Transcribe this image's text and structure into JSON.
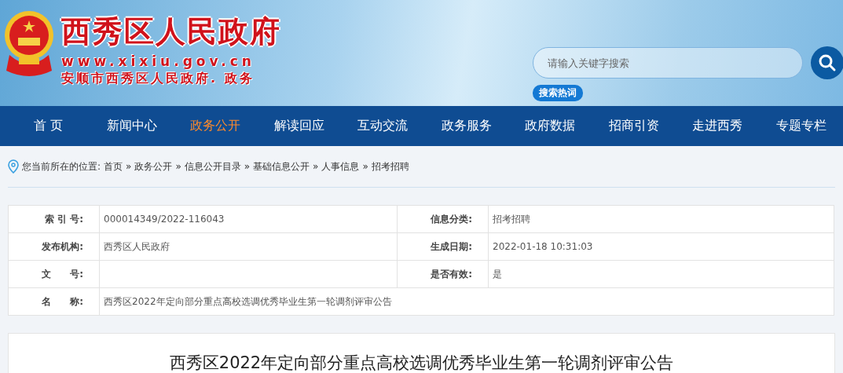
{
  "header": {
    "site_name": "西秀区人民政府",
    "url": "www.xixiu.gov.cn",
    "subtitle": "安顺市西秀区人民政府. 政务",
    "search": {
      "placeholder": "请输入关键字搜索"
    },
    "hot_words": "搜索热词"
  },
  "nav": [
    {
      "label": "首 页",
      "selected": false
    },
    {
      "label": "新闻中心",
      "selected": false
    },
    {
      "label": "政务公开",
      "selected": true
    },
    {
      "label": "解读回应",
      "selected": false
    },
    {
      "label": "互动交流",
      "selected": false
    },
    {
      "label": "政务服务",
      "selected": false
    },
    {
      "label": "政府数据",
      "selected": false
    },
    {
      "label": "招商引资",
      "selected": false
    },
    {
      "label": "走进西秀",
      "selected": false
    },
    {
      "label": "专题专栏",
      "selected": false
    }
  ],
  "breadcrumb": {
    "prefix": "您当前所在的位置:",
    "separator": "»",
    "items": [
      "首页",
      "政务公开",
      "信息公开目录",
      "基础信息公开",
      "人事信息",
      "招考招聘"
    ]
  },
  "info_table": {
    "rows": [
      {
        "cells": [
          {
            "label": "索 引 号:",
            "value": "000014349/2022-116043"
          },
          {
            "label": "信息分类:",
            "value": "招考招聘"
          }
        ]
      },
      {
        "cells": [
          {
            "label": "发布机构:",
            "value": "西秀区人民政府"
          },
          {
            "label": "生成日期:",
            "value": "2022-01-18 10:31:03"
          }
        ]
      },
      {
        "cells": [
          {
            "label": "文　　号:"
          },
          {
            "label": "是否有效:",
            "value": "是"
          }
        ]
      },
      {
        "cells": [
          {
            "label": "名　　称:",
            "value": "西秀区2022年定向部分重点高校选调优秀毕业生第一轮调剂评审公告"
          }
        ]
      }
    ]
  },
  "article": {
    "title": "西秀区2022年定向部分重点高校选调优秀毕业生第一轮调剂评审公告"
  }
}
